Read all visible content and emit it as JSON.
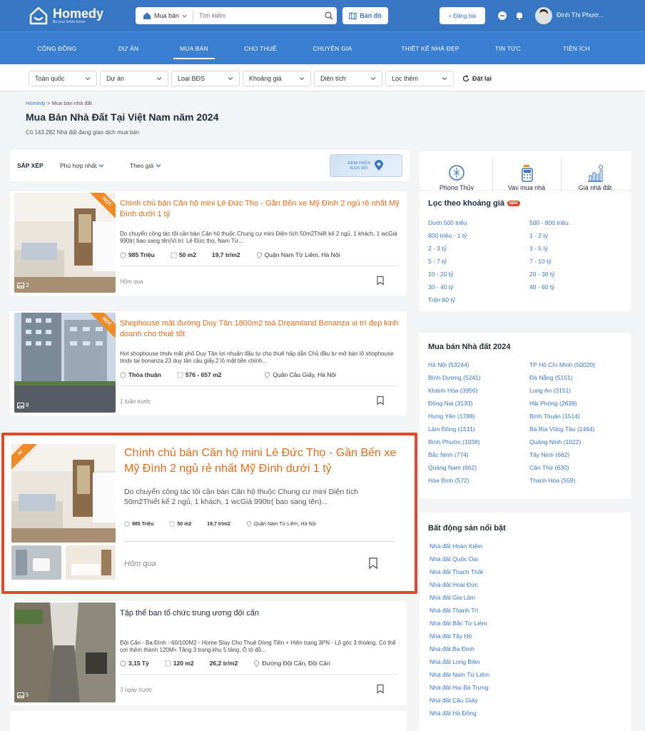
{
  "brand": {
    "name": "Homedy",
    "slogan": "Be your better home"
  },
  "search": {
    "type_label": "Mua bán",
    "placeholder": "Tìm kiếm"
  },
  "header": {
    "map_label": "Bản đồ",
    "post_label": "+ Đăng bài",
    "username": "Đinh Thị Phươ..."
  },
  "nav": [
    "CỘNG ĐỒNG",
    "DỰ ÁN",
    "MUA BÁN",
    "CHO THUÊ",
    "CHUYÊN GIA",
    "THIẾT KẾ NHÀ ĐẸP",
    "TIN TỨC",
    "TIỆN ÍCH"
  ],
  "filters": [
    "Toàn quốc",
    "Dự án",
    "Loại BĐS",
    "Khoảng giá",
    "Diện tích",
    "Lọc thêm"
  ],
  "filter_reset": "Đặt lại",
  "breadcrumb": {
    "home": "Homedy",
    "sep": ">",
    "current": "Mua bán nhà đất"
  },
  "page": {
    "title": "Mua Bán Nhà Đất Tại Việt Nam năm 2024",
    "subtitle": "Có 143.282 Nhà đất đang giao dịch mua bán"
  },
  "sort": {
    "label": "SẮP XẾP",
    "option1": "Phù hợp nhất",
    "option2": "Theo giá",
    "map_line1": "XEM TRÊN",
    "map_line2": "BẢN ĐỒ"
  },
  "listings": [
    {
      "badge": "HOT",
      "image_count": "3",
      "title": "Chính chủ bán Căn hộ mini Lê Đức Thọ - Gần Bến xe Mỹ Đình 2 ngủ rẻ nhất Mỹ Đình dưới 1 tỷ",
      "description": "Do chuyển công tác tôi cần bán Căn hộ thuộc Chung cư mini Diện tích 50m2Thiết kế 2 ngủ, 1 khách, 1 wcGiá 990tr( bao sang tên)Vị trí: Lê Đức thọ, Nam Từ...",
      "price": "985 Triệu",
      "area": "50 m2",
      "unit_price": "19,7 tr/m2",
      "location": "Quận Nam Từ Liêm, Hà Nội",
      "time": "Hôm qua"
    },
    {
      "badge": "HOT",
      "image_count": "8",
      "title": "Shophouse mặt đường Duy Tân 1800m2 toà Dreamland Bonanza vị trí đẹp kinh doanh cho thuê tốt",
      "description": "Hot shophouse tmdv mặt phố Duy Tân lợi nhuận đầu tư cho thuê hấp dẫn Chủ đầu tư mở bán lô shophouse tmdv tại bonanza 23 duy tân cầu giấy.2 lô mặt tiền chính...",
      "price": "Thỏa thuận",
      "area": "576 - 657 m2",
      "unit_price": "",
      "location": "Quận Cầu Giấy, Hà Nội",
      "time": "1 tuần trước"
    },
    {
      "badge": "AI",
      "image_count": "",
      "title": "Chính chủ bán Căn hộ mini Lê Đức Thọ - Gần Bến xe Mỹ Đình 2 ngủ rẻ nhất Mỹ Đình dưới 1 tỷ",
      "description": "Do chuyển công tác tôi cần bán Căn hộ thuộc Chung cư mini Diện tích 50m2Thiết kế 2 ngủ, 1 khách, 1 wcGiá 990tr( bao sang tên)...",
      "price": "985 Triệu",
      "area": "50 m2",
      "unit_price": "19,7 tr/m2",
      "location": "Quận Nam Từ Liêm, Hà Nội",
      "time": "Hôm qua"
    },
    {
      "badge": "",
      "image_count": "5",
      "title": "Tập thể ban tổ chức trung ương đội cấn",
      "description": "Đội Cấn - Ba Đình - 60/100M2 - Home Stay Cho Thuê Dòng Tiền + Hiện trạng 3PN - Lô góc 3 thoáng. Có thể cơi thêm thành 120M+ Tầng 3 trong khu 5 tầng. Ô tô đỗ...",
      "price": "3,15 Tỷ",
      "area": "120 m2",
      "unit_price": "26,2 tr/m2",
      "location": "Đường Đội Cấn, Đội Cấn",
      "time": "3 ngày trước"
    }
  ],
  "tools": [
    "Phong Thủy",
    "Vay mua nhà",
    "Giá nhà đất"
  ],
  "price_filter": {
    "title": "Lọc theo khoảng giá",
    "new_badge": "NEW",
    "items": [
      "Dưới 500 triệu",
      "500 - 800 triệu",
      "800 triệu - 1 tỷ",
      "1 - 2 tỷ",
      "2 - 3 tỷ",
      "3 - 5 tỷ",
      "5 - 7 tỷ",
      "7 - 10 tỷ",
      "10 - 20 tỷ",
      "20 - 30 tỷ",
      "30 - 40 tỷ",
      "40 - 60 tỷ",
      "Trên 60 tỷ"
    ]
  },
  "regions": {
    "title": "Mua bán Nhà đất 2024",
    "items": [
      "Hà Nội (53244)",
      "TP Hồ Chí Minh (50020)",
      "Bình Dương (5241)",
      "Đà Nẵng (5151)",
      "Khánh Hòa (3956)",
      "Long An (3151)",
      "Đồng Nai (3133)",
      "Hải Phòng (2638)",
      "Hưng Yên (1788)",
      "Bình Thuận (1514)",
      "Lâm Đồng (1511)",
      "Bà Rịa Vũng Tàu (1464)",
      "Bình Phước (1038)",
      "Quảng Ninh (1022)",
      "Bắc Ninh (774)",
      "Tây Ninh (662)",
      "Quảng Nam (662)",
      "Cần Thơ (630)",
      "Hòa Bình (572)",
      "Thanh Hóa (559)"
    ]
  },
  "featured": {
    "title": "Bất động sản nổi bật",
    "items": [
      "Nhà đất Hoàn Kiếm",
      "Nhà đất Quốc Oai",
      "Nhà đất Thạch Thất",
      "Nhà đất Hoài Đức",
      "Nhà đất Gia Lâm",
      "Nhà đất Thanh Trì",
      "Nhà đất Bắc Từ Liêm",
      "Nhà đất Tây Hồ",
      "Nhà đất Ba Đình",
      "Nhà đất Long Biên",
      "Nhà đất Nam Từ Liêm",
      "Nhà đất Hai Bà Trưng",
      "Nhà đất Cầu Giấy",
      "Nhà đất Hà Đông"
    ]
  },
  "colors": {
    "brand": "#3676c2",
    "nav": "#3a7fcf",
    "title_orange": "#e96a15",
    "hot_badge": "#f08a24",
    "highlight": "#e0482a",
    "link": "#3676c2"
  }
}
